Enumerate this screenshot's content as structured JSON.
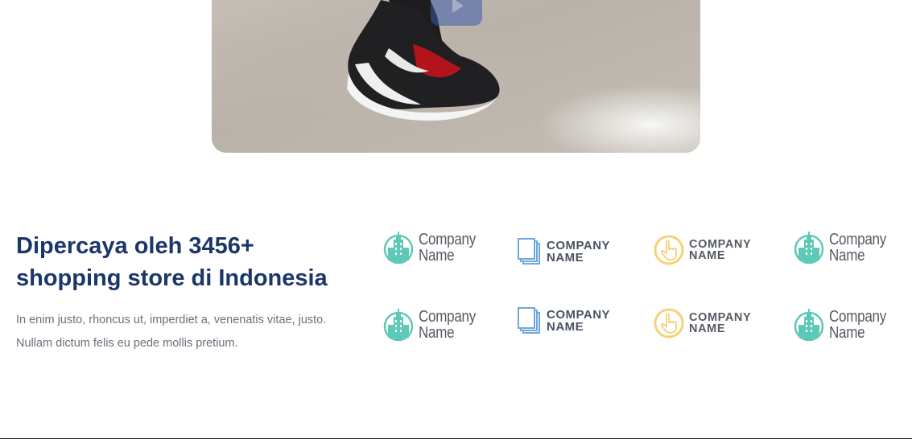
{
  "video": {
    "play_icon": "play-icon"
  },
  "trust": {
    "headline": "Dipercaya oleh 3456+ shopping store di Indonesia",
    "description": "In enim justo, rhoncus ut, imperdiet a, venenatis vitae, justo. Nullam dictum felis eu pede mollis pretium."
  },
  "logos": [
    {
      "style": "building",
      "line1": "Company",
      "line2": "Name",
      "icon": "building-icon",
      "color": "#5fc9b8"
    },
    {
      "style": "pages",
      "line1": "COMPANY",
      "line2": "NAME",
      "icon": "pages-icon",
      "color": "#6fa8dc"
    },
    {
      "style": "hand",
      "line1": "COMPANY",
      "line2": "NAME",
      "icon": "hand-pointer-icon",
      "color": "#f5d27a"
    },
    {
      "style": "building",
      "line1": "Company",
      "line2": "Name",
      "icon": "building-icon",
      "color": "#5fc9b8"
    },
    {
      "style": "building",
      "line1": "Company",
      "line2": "Name",
      "icon": "building-icon",
      "color": "#5fc9b8"
    },
    {
      "style": "pages",
      "line1": "COMPANY",
      "line2": "NAME",
      "icon": "pages-icon",
      "color": "#6fa8dc"
    },
    {
      "style": "hand",
      "line1": "COMPANY",
      "line2": "NAME",
      "icon": "hand-pointer-icon",
      "color": "#f5d27a"
    },
    {
      "style": "building",
      "line1": "Company",
      "line2": "Name",
      "icon": "building-icon",
      "color": "#5fc9b8"
    }
  ]
}
